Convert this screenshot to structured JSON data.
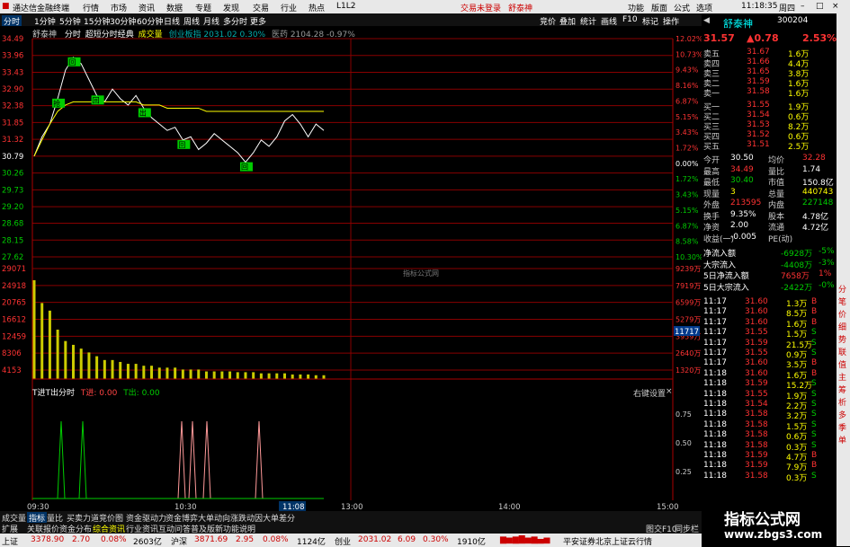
{
  "titlebar": {
    "app": "通达信金融终端",
    "menus": [
      "行情",
      "市场",
      "资讯",
      "数据",
      "专题",
      "发现",
      "交易",
      "行业",
      "热点",
      "L1L2"
    ],
    "login": "交易未登录",
    "stock": "舒泰神",
    "right_menus": [
      "功能",
      "版面",
      "公式",
      "选项"
    ],
    "time": "11:18:35",
    "weekday": "周四"
  },
  "tabs": [
    "分时",
    "1分钟",
    "5分钟",
    "15分钟",
    "30分钟",
    "60分钟",
    "日线",
    "周线",
    "月线",
    "多分时",
    "更多"
  ],
  "chart_tools": [
    "竞价",
    "叠加",
    "统计",
    "画线",
    "F10",
    "标记",
    "操作"
  ],
  "info": {
    "stock": "舒泰神",
    "mode": "分时",
    "formula": "超短分时经典",
    "vol": "成交量",
    "idx": "创业板指 2031.02 0.30%",
    "sector": "医药 2104.28 -0.97%"
  },
  "chart_data": {
    "type": "line",
    "title": "舒泰神 分时",
    "prev_close": 30.79,
    "y_ticks": [
      "34.49",
      "33.96",
      "33.43",
      "32.90",
      "32.38",
      "31.85",
      "31.32",
      "30.79",
      "30.26",
      "29.73",
      "29.20",
      "28.68",
      "28.15",
      "27.62"
    ],
    "pct_ticks": [
      "12.02%",
      "10.73%",
      "9.43%",
      "8.16%",
      "6.87%",
      "5.15%",
      "3.43%",
      "1.72%",
      "0.00%",
      "1.72%",
      "3.43%",
      "5.15%",
      "6.87%",
      "8.58%",
      "10.30%"
    ],
    "vol_ticks": [
      "29071",
      "24918",
      "20765",
      "16612",
      "12459",
      "8306",
      "4153"
    ],
    "vol_right": [
      "9239万",
      "7919万",
      "6599万",
      "5279万",
      "3959万",
      "2640万",
      "1320万"
    ],
    "vol_last": "11717",
    "time_ticks": [
      "09:30",
      "10:30",
      "11:08",
      "13:00",
      "14:00",
      "15:00"
    ],
    "price": [
      30.79,
      31.4,
      31.8,
      32.6,
      33.5,
      33.9,
      33.7,
      33.2,
      32.7,
      32.5,
      32.9,
      32.6,
      32.4,
      32.7,
      32.3,
      32.0,
      31.8,
      31.6,
      31.7,
      31.3,
      31.4,
      31.0,
      31.2,
      31.5,
      31.3,
      31.1,
      30.9,
      30.6,
      30.9,
      31.3,
      31.1,
      31.4,
      31.9,
      32.1,
      31.8,
      31.4,
      31.8,
      31.6
    ],
    "avg": [
      30.79,
      31.3,
      31.8,
      32.2,
      32.4,
      32.5,
      32.5,
      32.5,
      32.5,
      32.5,
      32.5,
      32.5,
      32.5,
      32.5,
      32.4,
      32.4,
      32.4,
      32.3,
      32.3,
      32.3,
      32.3,
      32.3,
      32.2,
      32.2,
      32.2,
      32.2,
      32.2,
      32.2,
      32.2,
      32.2,
      32.2,
      32.2,
      32.2,
      32.2,
      32.2,
      32.2,
      32.2,
      32.2
    ],
    "volume": [
      26000,
      20000,
      18000,
      13000,
      10000,
      9000,
      8000,
      7000,
      6000,
      5000,
      5000,
      4500,
      4000,
      4000,
      3500,
      3500,
      3000,
      3000,
      3000,
      2500,
      2500,
      2500,
      2000,
      2000,
      2000,
      2000,
      1800,
      1800,
      1800,
      1500,
      1500,
      1500,
      1500,
      1200,
      1200,
      1200,
      1000,
      1000
    ],
    "labels": [
      "抢",
      "回",
      "回",
      "出",
      "回",
      "回"
    ]
  },
  "indicator": {
    "title": "T进T出分时",
    "t_in": "T进: 0.00",
    "t_out": "T出: 0.00",
    "y_ticks": [
      "0.75",
      "0.50",
      "0.25"
    ],
    "settings": "右键设置"
  },
  "quote": {
    "name": "舒泰神",
    "code": "300204",
    "price": "31.57",
    "change": "▲0.78",
    "pct": "2.53%",
    "asks": [
      [
        "卖五",
        "31.67",
        "1.6万"
      ],
      [
        "卖四",
        "31.66",
        "4.4万"
      ],
      [
        "卖三",
        "31.65",
        "3.8万"
      ],
      [
        "卖二",
        "31.59",
        "1.6万"
      ],
      [
        "卖一",
        "31.58",
        "1.6万"
      ]
    ],
    "bids": [
      [
        "买一",
        "31.55",
        "1.9万"
      ],
      [
        "买二",
        "31.54",
        "0.6万"
      ],
      [
        "买三",
        "31.53",
        "8.2万"
      ],
      [
        "买四",
        "31.52",
        "0.6万"
      ],
      [
        "买五",
        "31.51",
        "2.5万"
      ]
    ],
    "stats": [
      [
        "今开",
        "30.50",
        "均价",
        "32.28"
      ],
      [
        "最高",
        "34.49",
        "量比",
        "1.74"
      ],
      [
        "最低",
        "30.40",
        "市值",
        "150.8亿"
      ],
      [
        "现量",
        "3",
        "总量",
        "440743"
      ],
      [
        "外盘",
        "213595",
        "内盘",
        "227148"
      ],
      [
        "换手",
        "9.35%",
        "股本",
        "4.78亿"
      ],
      [
        "净资",
        "2.00",
        "流通",
        "4.72亿"
      ],
      [
        "收益(一)",
        "-0.005",
        "PE(动)",
        ""
      ]
    ],
    "flows": [
      [
        "净流入额",
        "-6928万",
        "-5%"
      ],
      [
        "大宗流入",
        "-4408万",
        "-3%"
      ],
      [
        "5日净流入额",
        "7658万",
        "1%"
      ],
      [
        "5日大宗流入",
        "-2422万",
        "-0%"
      ]
    ],
    "ticks": [
      [
        "11:17",
        "31.60",
        "1.3万",
        "B"
      ],
      [
        "11:17",
        "31.60",
        "8.5万",
        "B"
      ],
      [
        "11:17",
        "31.60",
        "1.6万",
        "B"
      ],
      [
        "11:17",
        "31.55",
        "1.5万",
        "S"
      ],
      [
        "11:17",
        "31.59",
        "21.5万",
        "S"
      ],
      [
        "11:17",
        "31.55",
        "0.9万",
        "S"
      ],
      [
        "11:17",
        "31.60",
        "3.5万",
        "B"
      ],
      [
        "11:18",
        "31.60",
        "1.6万",
        "B"
      ],
      [
        "11:18",
        "31.59",
        "15.2万",
        "S"
      ],
      [
        "11:18",
        "31.55",
        "1.9万",
        "S"
      ],
      [
        "11:18",
        "31.54",
        "2.2万",
        "S"
      ],
      [
        "11:18",
        "31.58",
        "3.2万",
        "S"
      ],
      [
        "11:18",
        "31.58",
        "1.5万",
        "S"
      ],
      [
        "11:18",
        "31.58",
        "0.6万",
        "S"
      ],
      [
        "11:18",
        "31.58",
        "0.3万",
        "S"
      ],
      [
        "11:18",
        "31.59",
        "4.7万",
        "B"
      ],
      [
        "11:18",
        "31.59",
        "7.9万",
        "B"
      ],
      [
        "11:18",
        "31.58",
        "0.3万",
        "S"
      ]
    ]
  },
  "sidebar": [
    "分",
    "笔",
    "价",
    "细",
    "势",
    "联",
    "值",
    "主",
    "筹",
    "析",
    "多",
    "季",
    "单"
  ],
  "bottom_tabs": [
    "成交量",
    "指标",
    "量比",
    "买卖力道",
    "竞价图",
    "资金驱动力",
    "资金博弈",
    "大单动向",
    "涨跌动因",
    "大单差分"
  ],
  "bottom_sub": [
    "扩展",
    "关联报价",
    "资金分布",
    "综合资讯",
    "行业资讯",
    "互动问答",
    "普及版新功能说明"
  ],
  "bottom_right": [
    "图交F10",
    "同步栏"
  ],
  "status": [
    [
      "上证",
      "3378.90",
      "2.70",
      "0.08%",
      "2603亿"
    ],
    [
      "沪深",
      "3871.69",
      "2.95",
      "0.08%",
      "1124亿"
    ],
    [
      "创业",
      "2031.02",
      "6.09",
      "0.30%",
      "1910亿"
    ]
  ],
  "status_right": "平安证券北京上证云行情",
  "watermark": "指标公式网",
  "logo": {
    "cn": "指标公式网",
    "url": "www.zbgs3.com"
  }
}
